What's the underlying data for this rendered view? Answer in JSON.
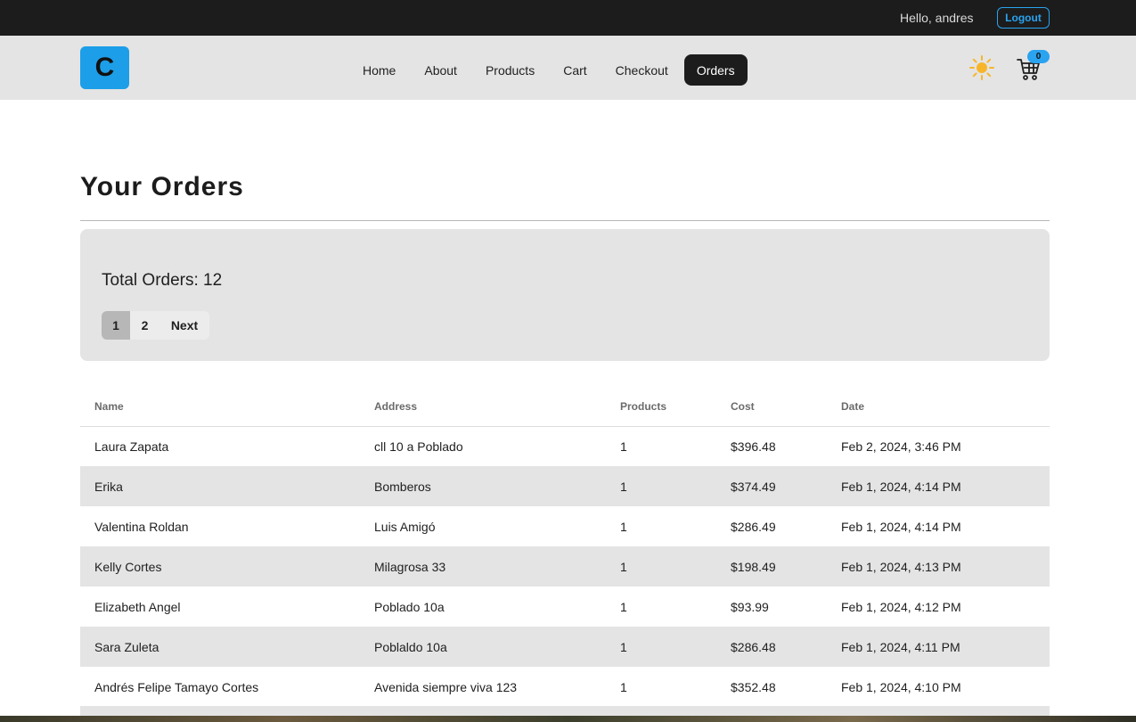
{
  "topbar": {
    "greeting": "Hello, andres",
    "logout_label": "Logout"
  },
  "navbar": {
    "logo_letter": "C",
    "links": [
      {
        "label": "Home"
      },
      {
        "label": "About"
      },
      {
        "label": "Products"
      },
      {
        "label": "Cart"
      },
      {
        "label": "Checkout"
      },
      {
        "label": "Orders",
        "active": true
      }
    ],
    "theme_icon": "sun-icon",
    "cart_icon": "cart-icon",
    "cart_count": "0"
  },
  "page": {
    "title": "Your Orders"
  },
  "stats": {
    "total_label": "Total Orders: 12",
    "pagination": {
      "pages": [
        "1",
        "2"
      ],
      "next_label": "Next",
      "current": "1"
    }
  },
  "table": {
    "headers": [
      "Name",
      "Address",
      "Products",
      "Cost",
      "Date"
    ],
    "rows": [
      [
        "Laura Zapata",
        "cll 10 a Poblado",
        "1",
        "$396.48",
        "Feb 2, 2024, 3:46 PM"
      ],
      [
        "Erika",
        "Bomberos",
        "1",
        "$374.49",
        "Feb 1, 2024, 4:14 PM"
      ],
      [
        "Valentina Roldan",
        "Luis Amigó",
        "1",
        "$286.49",
        "Feb 1, 2024, 4:14 PM"
      ],
      [
        "Kelly Cortes",
        "Milagrosa 33",
        "1",
        "$198.49",
        "Feb 1, 2024, 4:13 PM"
      ],
      [
        "Elizabeth Angel",
        "Poblado 10a",
        "1",
        "$93.99",
        "Feb 1, 2024, 4:12 PM"
      ],
      [
        "Sara Zuleta",
        "Poblaldo 10a",
        "1",
        "$286.48",
        "Feb 1, 2024, 4:11 PM"
      ],
      [
        "Andrés Felipe Tamayo Cortes",
        "Avenida siempre viva 123",
        "1",
        "$352.48",
        "Feb 1, 2024, 4:10 PM"
      ]
    ]
  },
  "colors": {
    "accent": "#2aa3f0",
    "logo_bg": "#1d9ee8",
    "topbar_bg": "#1c1c1c",
    "navbar_bg": "#e4e4e4",
    "sun": "#f7b52b"
  }
}
